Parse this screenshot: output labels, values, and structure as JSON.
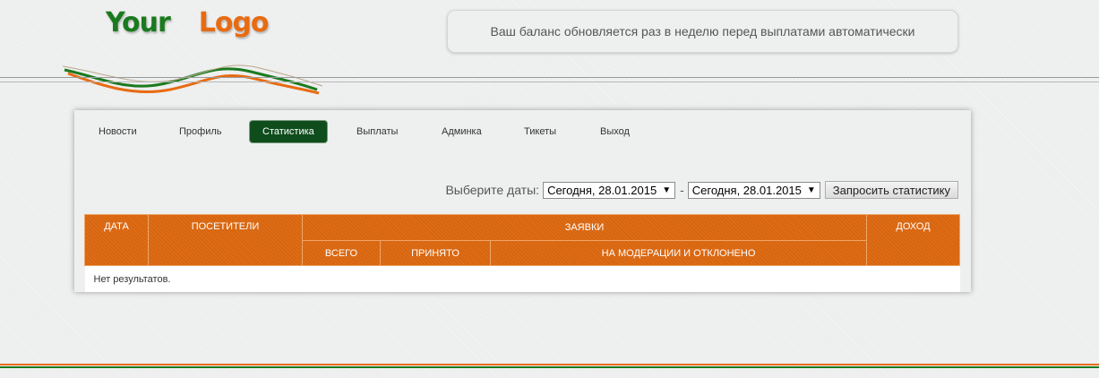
{
  "header": {
    "logo_word1": "Your",
    "logo_word2": "Logo",
    "notice": "Ваш баланс обновляется раз в неделю перед выплатами автоматически"
  },
  "nav": {
    "items": [
      {
        "label": "Новости",
        "active": false
      },
      {
        "label": "Профиль",
        "active": false
      },
      {
        "label": "Статистика",
        "active": true
      },
      {
        "label": "Выплаты",
        "active": false
      },
      {
        "label": "Админка",
        "active": false
      },
      {
        "label": "Тикеты",
        "active": false
      },
      {
        "label": "Выход",
        "active": false
      }
    ]
  },
  "filter": {
    "label": "Выберите даты:",
    "date_from": "Сегодня, 28.01.2015",
    "separator": "-",
    "date_to": "Сегодня, 28.01.2015",
    "submit_label": "Запросить статистику"
  },
  "table": {
    "columns": {
      "date": "Дата",
      "visitors": "Посетители",
      "requests": "Заявки",
      "income": "Доход",
      "total": "Всего",
      "accepted": "Принято",
      "moderation": "На модерации и отклонено"
    },
    "empty_text": "Нет результатов."
  },
  "colors": {
    "accent_orange": "#d9650d",
    "accent_green": "#0f4d1c",
    "logo_green": "#1a7a1e",
    "logo_orange": "#e86b12"
  }
}
